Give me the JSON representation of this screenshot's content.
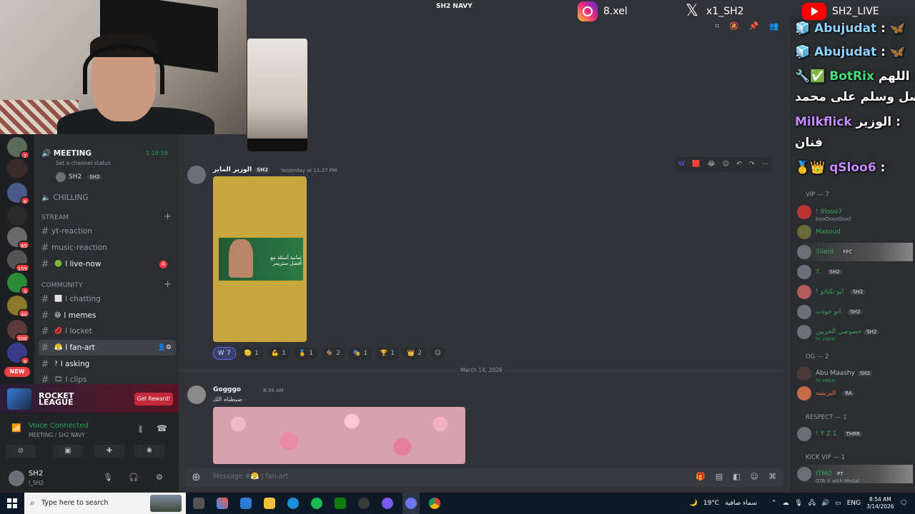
{
  "stream": {
    "title": "SH2 NAVY",
    "instagram": "8.xel",
    "x": "x1_SH2",
    "youtube": "SH2_LIVE"
  },
  "channels": {
    "meeting": "MEETING",
    "timer": "1:18:59",
    "status": "Set a channel status",
    "vc_user": "SH2",
    "vc_user_tag": "SH2",
    "chilling": "CHILLING",
    "cat_stream": "STREAM",
    "cat_community": "COMMUNITY",
    "items": [
      {
        "label": "yt-reaction"
      },
      {
        "label": "music-reaction"
      },
      {
        "label": "l live-now",
        "badge": "4"
      },
      {
        "label": "l chatting"
      },
      {
        "label": "l memes"
      },
      {
        "label": "l locket"
      },
      {
        "label": "l fan-art"
      },
      {
        "label": "l asking"
      },
      {
        "label": "l clips"
      }
    ]
  },
  "servers": [
    {
      "badge": "7"
    },
    {
      "badge": ""
    },
    {
      "badge": "8"
    },
    {
      "badge": ""
    },
    {
      "badge": "65"
    },
    {
      "badge": "155"
    },
    {
      "badge": "3"
    },
    {
      "badge": "40"
    },
    {
      "badge": "306"
    },
    {
      "badge": "9"
    }
  ],
  "new_label": "NEW",
  "promo": {
    "logo": "ROCKET LEAGUE",
    "cta": "Get Reward!"
  },
  "voice": {
    "title": "Voice Connected",
    "sub": "MEETING / SH2 NAVY"
  },
  "user": {
    "name": "SH2",
    "sub": "l_SH2"
  },
  "messages": {
    "m1": {
      "author": "الوزير الماير",
      "tag": "SH2",
      "time": "Yesterday at 11:27 PM"
    },
    "fanart_text": "ثمانية أسئلة مع أفضل ستريمر",
    "reactions": [
      {
        "emoji": "W",
        "count": "7"
      },
      {
        "emoji": "🫡",
        "count": "1"
      },
      {
        "emoji": "💪",
        "count": "1"
      },
      {
        "emoji": "🏅",
        "count": "1"
      },
      {
        "emoji": "🐐",
        "count": "2"
      },
      {
        "emoji": "🎭",
        "count": "1"
      },
      {
        "emoji": "🏆",
        "count": "1"
      },
      {
        "emoji": "👑",
        "count": "2"
      }
    ],
    "date_divider": "March 14, 2026",
    "m2": {
      "author": "Gogggo",
      "time": "8:36 AM",
      "text": "ضبطناه الك"
    }
  },
  "composer": {
    "placeholder": "Message #😤 ǀ fan-art"
  },
  "chat": [
    {
      "user": "Abujudat",
      "msg": ":"
    },
    {
      "user": "Abujudat",
      "msg": ":"
    },
    {
      "user": "BotRix",
      "msg": "اللهم :"
    },
    {
      "user": "",
      "msg": "صل وسلم على محمد"
    },
    {
      "user": "Milkflick",
      "msg": "الوزير :"
    },
    {
      "user": "",
      "msg": "فنان"
    },
    {
      "user": "qSloo6",
      "msg": ":"
    }
  ],
  "members": {
    "vip_cat": "VIP — 7",
    "vip": [
      {
        "name": "! 9looo7",
        "status": "booOoooOoo0"
      },
      {
        "name": "Masoud",
        "status": ""
      },
      {
        "name": "Silent",
        "tag": "FFC"
      },
      {
        "name": "Y.",
        "tag": "SH2"
      },
      {
        "name": "! ابو تكتاتو",
        "tag": "SH2"
      },
      {
        "name": "ابو جودت",
        "tag": "SH2"
      },
      {
        "name": "خصوصي الحزبين",
        "tag": "SH2",
        "status": "In voice"
      }
    ],
    "og_cat": "OG — 2",
    "og": [
      {
        "name": "Abu Maashy",
        "tag": "SH2",
        "status": "In voice"
      },
      {
        "name": "البرنيتيه",
        "tag": "RA"
      }
    ],
    "respect_cat": "RESPECT — 1",
    "respect": [
      {
        "name": "! Y Z 1",
        "tag": "THRR"
      }
    ],
    "kickvip_cat": "KICK VIP — 1",
    "kickvip": [
      {
        "name": "ITMO",
        "tag": "PT",
        "status": "GTA V with Medal"
      }
    ]
  },
  "taskbar": {
    "search": "Type here to search",
    "weather_temp": "19°C",
    "weather_text": "سماء صافية",
    "lang": "ENG",
    "time": "8:54 AM",
    "date": "3/14/2026"
  }
}
